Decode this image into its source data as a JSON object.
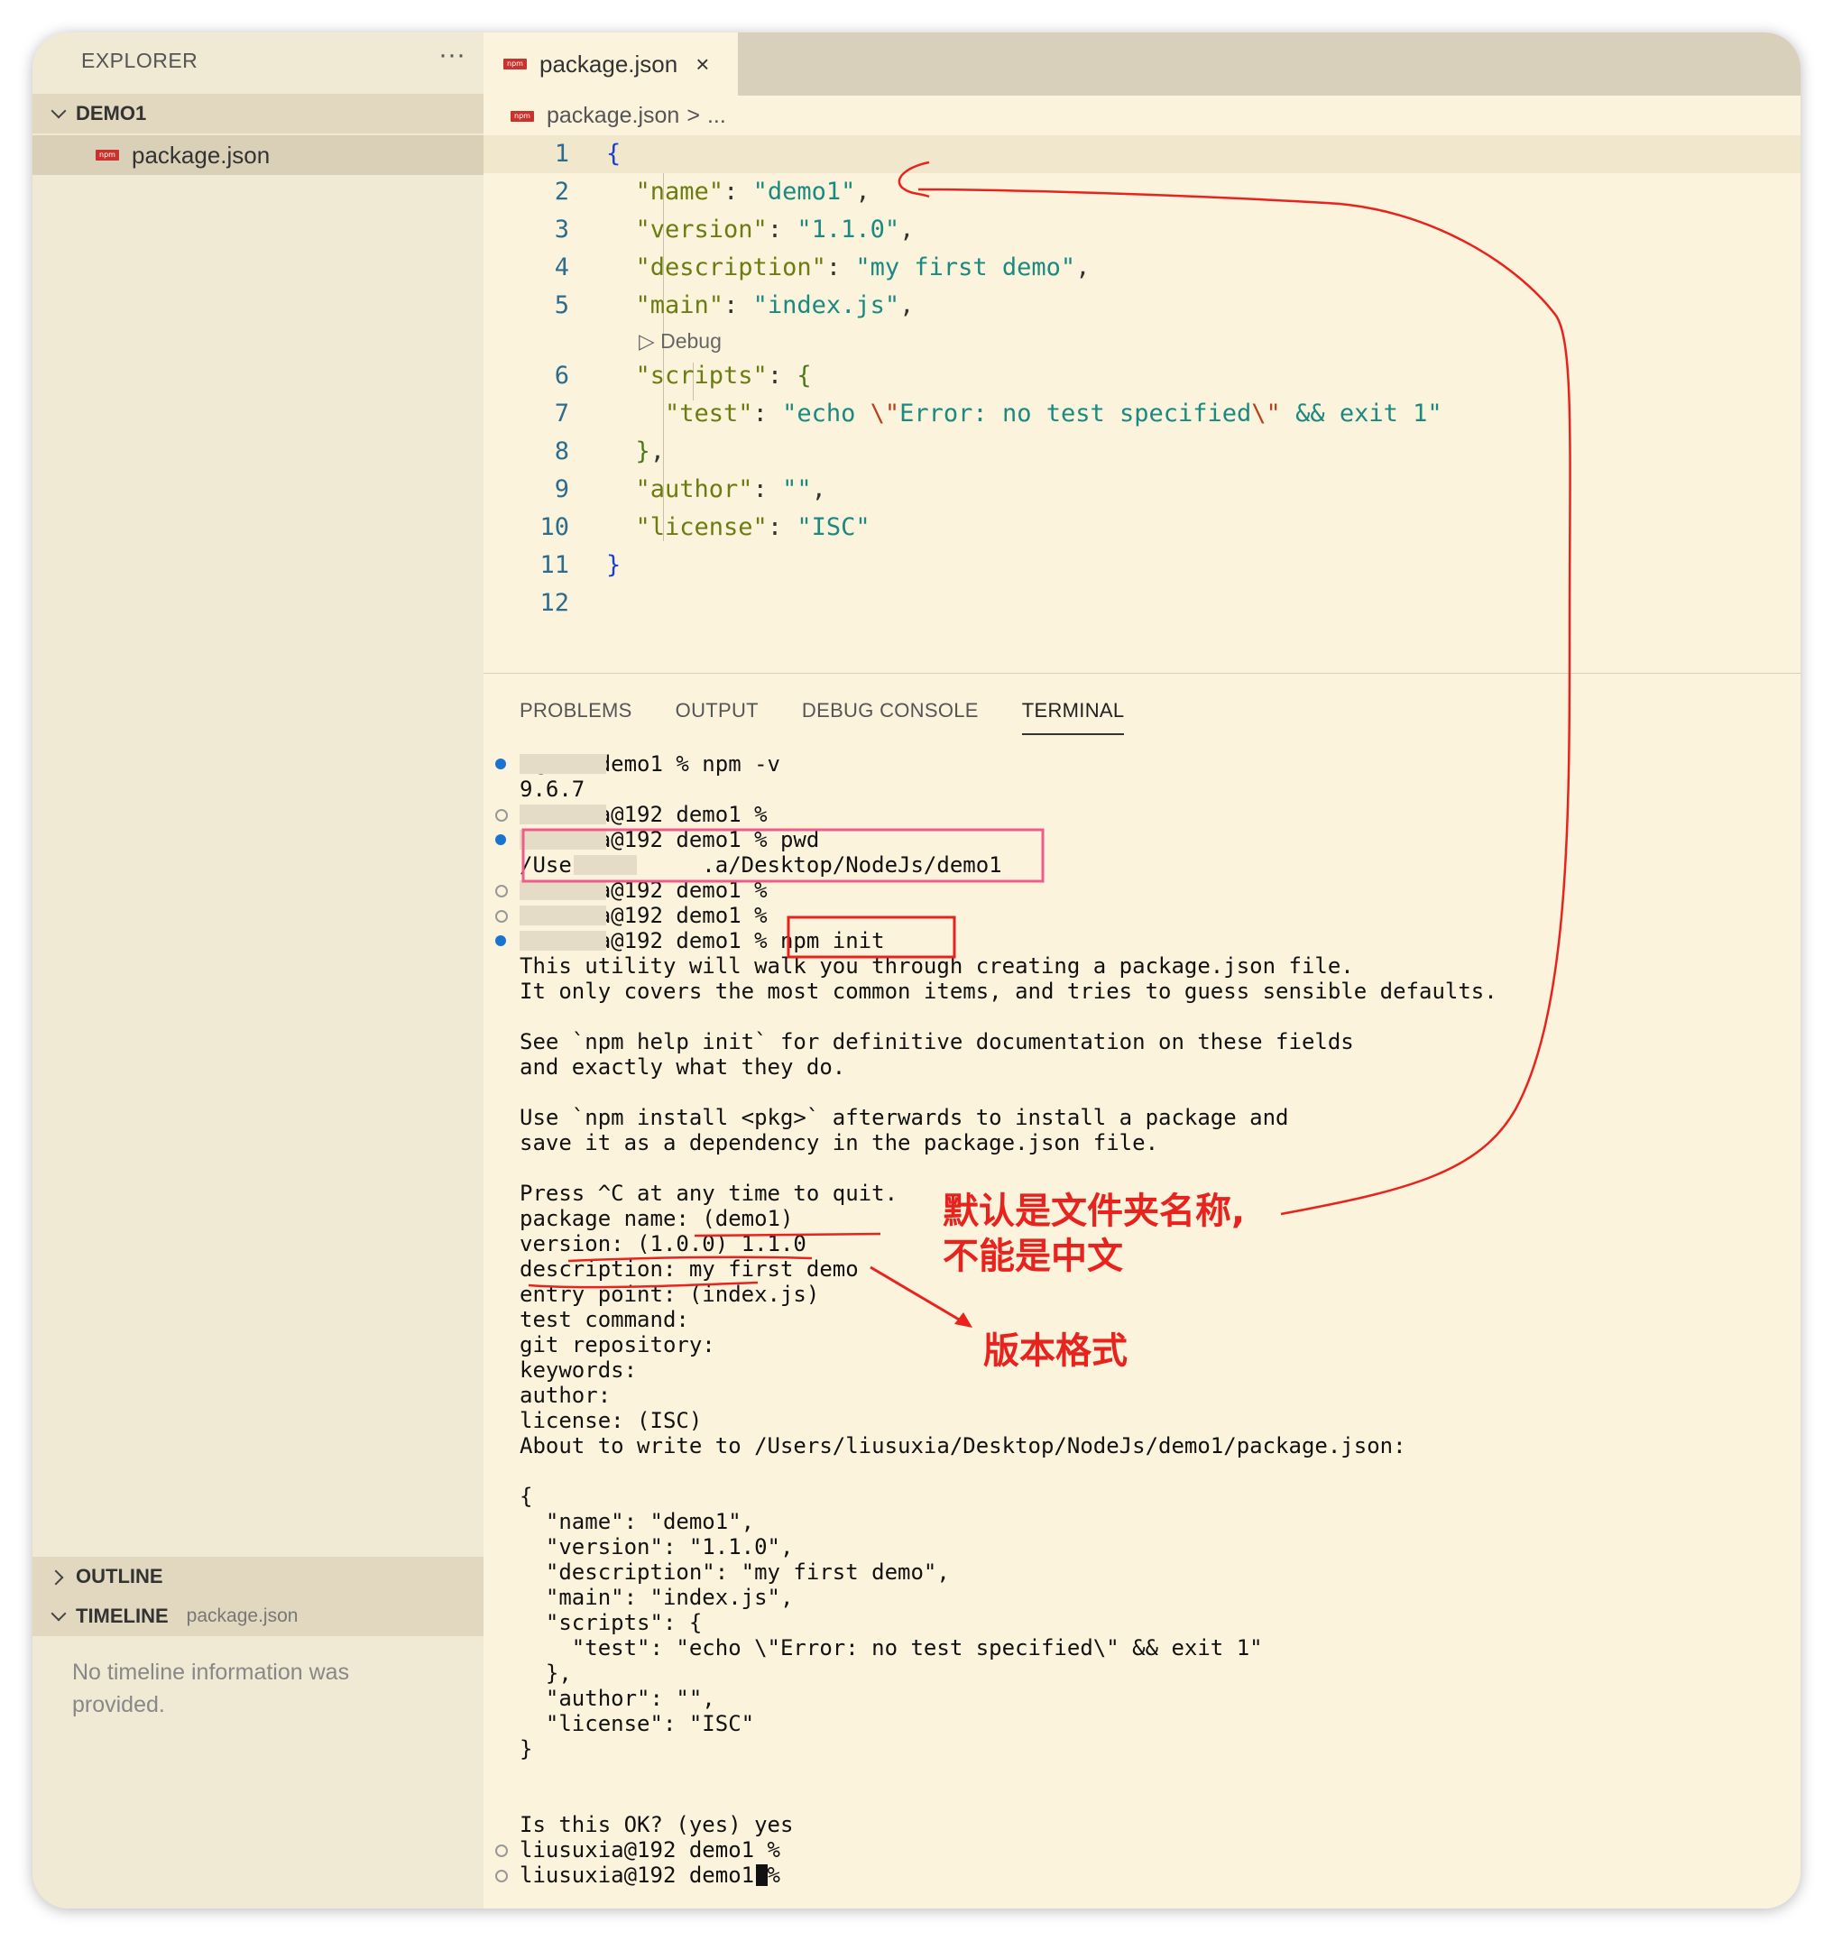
{
  "sidebar": {
    "title": "EXPLORER",
    "more": "···",
    "folder": "DEMO1",
    "file": "package.json",
    "outline": "OUTLINE",
    "timeline": "TIMELINE",
    "timeline_file": "package.json",
    "timeline_empty": "No timeline information was provided."
  },
  "editor": {
    "tab_label": "package.json",
    "tab_close": "×",
    "breadcrumb_file": "package.json",
    "breadcrumb_sep": ">",
    "breadcrumb_more": "...",
    "codelens": "Debug",
    "line_numbers": [
      "1",
      "2",
      "3",
      "4",
      "5",
      "6",
      "7",
      "8",
      "9",
      "10",
      "11",
      "12"
    ]
  },
  "panel": {
    "tabs": [
      "PROBLEMS",
      "OUTPUT",
      "DEBUG CONSOLE",
      "TERMINAL"
    ],
    "active_tab": "TERMINAL"
  },
  "terminal": {
    "lines": [
      "a@192 demo1 % npm -v",
      "9.6.7",
      "l'    a@192 demo1 %",
      "l     a@192 demo1 % pwd",
      "/Users/li     .a/Desktop/NodeJs/demo1",
      "l     a@192 demo1 %",
      "l     a@192 demo1 %",
      "l     a@192 demo1 % npm init",
      "This utility will walk you through creating a package.json file.",
      "It only covers the most common items, and tries to guess sensible defaults.",
      "",
      "See `npm help init` for definitive documentation on these fields",
      "and exactly what they do.",
      "",
      "Use `npm install <pkg>` afterwards to install a package and",
      "save it as a dependency in the package.json file.",
      "",
      "Press ^C at any time to quit.",
      "package name: (demo1)",
      "version: (1.0.0) 1.1.0",
      "description: my first demo",
      "entry point: (index.js)",
      "test command:",
      "git repository:",
      "keywords:",
      "author:",
      "license: (ISC)",
      "About to write to /Users/liusuxia/Desktop/NodeJs/demo1/package.json:",
      "",
      "{",
      "  \"name\": \"demo1\",",
      "  \"version\": \"1.1.0\",",
      "  \"description\": \"my first demo\",",
      "  \"main\": \"index.js\",",
      "  \"scripts\": {",
      "    \"test\": \"echo \\\"Error: no test specified\\\" && exit 1\"",
      "  },",
      "  \"author\": \"\",",
      "  \"license\": \"ISC\"",
      "}",
      "",
      "",
      "Is this OK? (yes) yes",
      "liusuxia@192 demo1 %",
      "liusuxia@192 demo1 % "
    ]
  },
  "annotations": {
    "note1": "默认是文件夹名称,\n不能是中文",
    "note2": "版本格式",
    "color": "#e8231e"
  }
}
